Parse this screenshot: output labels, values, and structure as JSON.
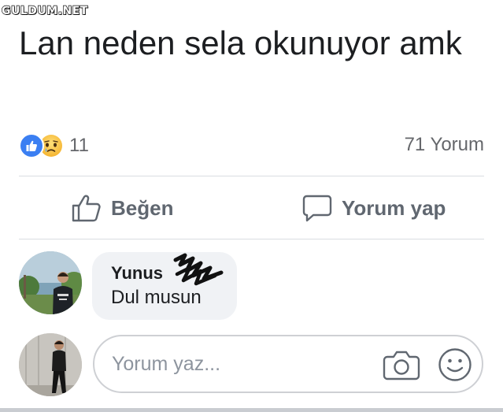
{
  "watermark": "GULDUM.NET",
  "post": {
    "text": "Lan neden sela okunuyor amk"
  },
  "reactions": {
    "icons": [
      "like-icon",
      "sad-icon"
    ],
    "count": "11",
    "comments_count": "71 Yorum"
  },
  "actions": {
    "like_label": "Beğen",
    "comment_label": "Yorum yap"
  },
  "comment": {
    "author": "Yunus",
    "text": "Dul musun"
  },
  "composer": {
    "placeholder": "Yorum yaz..."
  },
  "colors": {
    "like_blue": "#3b7ff2",
    "text_secondary": "#65676b",
    "bubble_bg": "#f0f2f5"
  }
}
